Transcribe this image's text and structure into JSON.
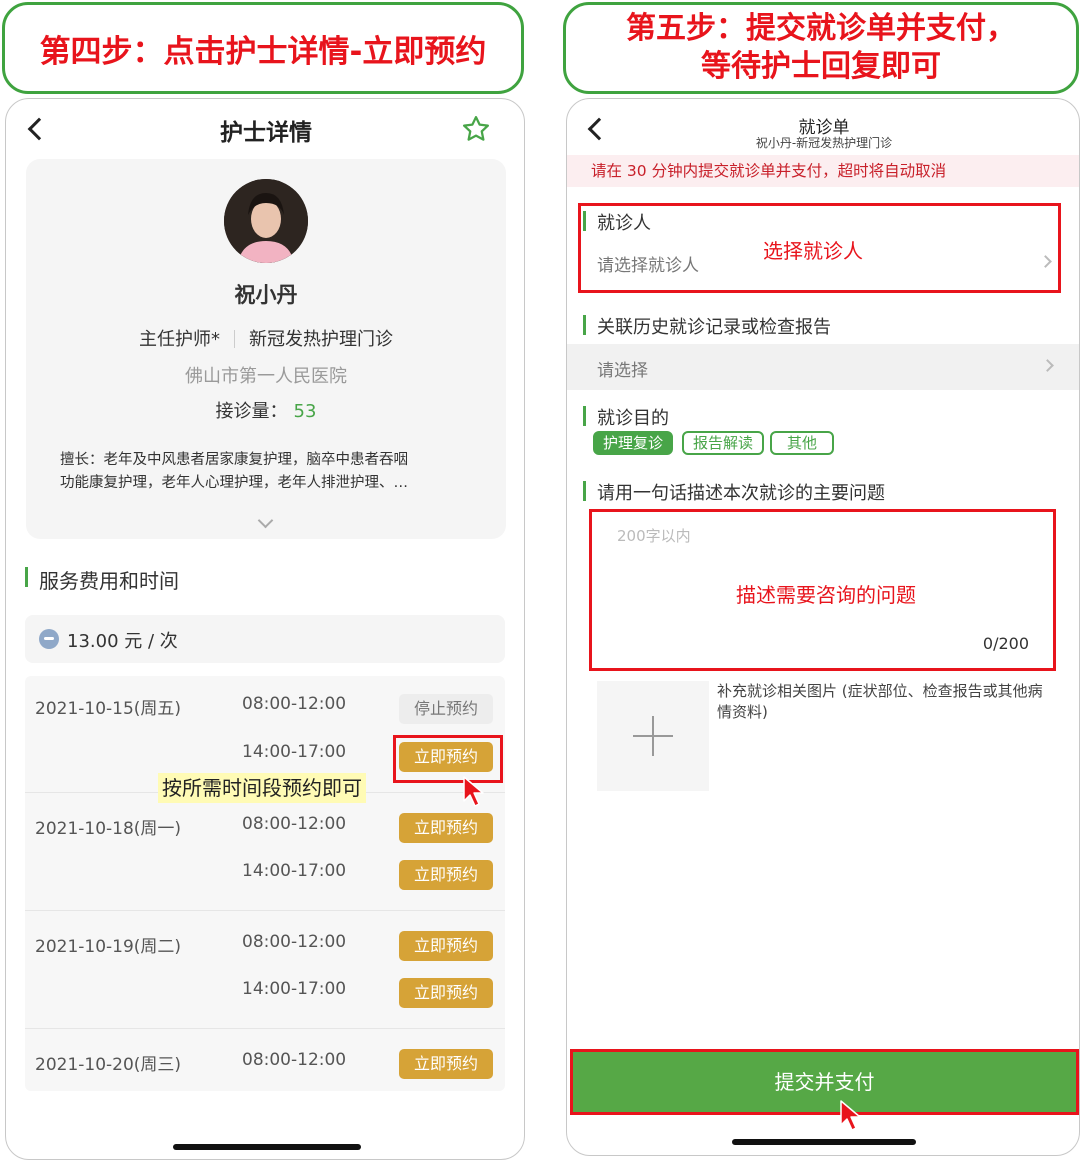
{
  "banners": {
    "left": "第四步：点击护士详情-立即预约",
    "right_line1": "第五步：提交就诊单并支付，",
    "right_line2": "等待护士回复即可"
  },
  "nurse_detail": {
    "title": "护士详情",
    "nurse": {
      "name": "祝小丹",
      "position": "主任护师*",
      "department": "新冠发热护理门诊",
      "hospital": "佛山市第一人民医院",
      "consult_label": "接诊量：",
      "consult_count": "53",
      "specialty_line1": "擅长：老年及中风患者居家康复护理，脑卒中患者吞咽",
      "specialty_line2": "功能康复护理，老年人心理护理，老年人排泄护理、…"
    },
    "service_section": "服务费用和时间",
    "fee": "13.00 元 / 次",
    "schedule": [
      {
        "date": "2021-10-15(周五)",
        "slots": [
          {
            "time": "08:00-12:00",
            "action": "停止预约"
          },
          {
            "time": "14:00-17:00",
            "action": "立即预约"
          }
        ]
      },
      {
        "date": "2021-10-18(周一)",
        "slots": [
          {
            "time": "08:00-12:00",
            "action": "立即预约"
          },
          {
            "time": "14:00-17:00",
            "action": "立即预约"
          }
        ]
      },
      {
        "date": "2021-10-19(周二)",
        "slots": [
          {
            "time": "08:00-12:00",
            "action": "立即预约"
          },
          {
            "time": "14:00-17:00",
            "action": "立即预约"
          }
        ]
      },
      {
        "date": "2021-10-20(周三)",
        "slots": [
          {
            "time": "08:00-12:00",
            "action": "立即预约"
          }
        ]
      }
    ],
    "hint": "按所需时间段预约即可"
  },
  "order_form": {
    "title": "就诊单",
    "subtitle": "祝小丹-新冠发热护理门诊",
    "notice": "请在 30 分钟内提交就诊单并支付，超时将自动取消",
    "patient_label": "就诊人",
    "patient_placeholder": "请选择就诊人",
    "patient_annotation": "选择就诊人",
    "history_label": "关联历史就诊记录或检查报告",
    "history_placeholder": "请选择",
    "purpose_label": "就诊目的",
    "purpose_tags": [
      "护理复诊",
      "报告解读",
      "其他"
    ],
    "description_label": "请用一句话描述本次就诊的主要问题",
    "description_placeholder": "200字以内",
    "description_annotation": "描述需要咨询的问题",
    "description_counter": "0/200",
    "upload_hint": "补充就诊相关图片 (症状部位、检查报告或其他病情资料)",
    "submit_label": "提交并支付"
  },
  "colors": {
    "annotation_red": "#e8141c",
    "brand_green": "#48a548",
    "book_button": "#d6a337",
    "submit_green": "#56a846"
  },
  "icons": [
    "back-arrow-icon",
    "star-icon",
    "chevron-down-icon",
    "chat-bubble-icon",
    "chevron-right-icon",
    "plus-icon",
    "cursor-icon"
  ]
}
